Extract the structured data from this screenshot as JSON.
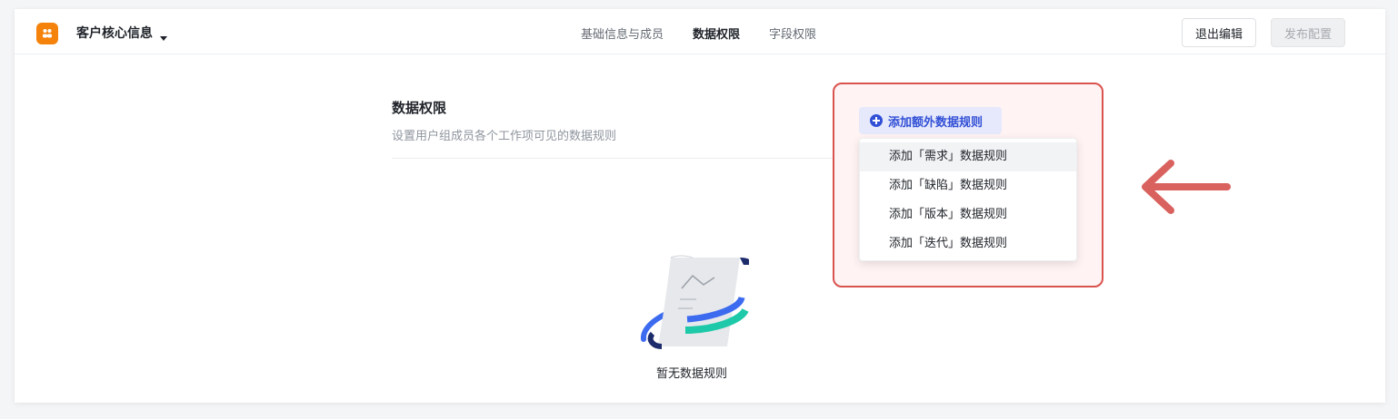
{
  "header": {
    "project_name": "客户核心信息",
    "tabs": [
      {
        "label": "基础信息与成员",
        "active": false
      },
      {
        "label": "数据权限",
        "active": true
      },
      {
        "label": "字段权限",
        "active": false
      }
    ],
    "exit_edit_label": "退出编辑",
    "publish_label": "发布配置"
  },
  "section": {
    "title": "数据权限",
    "description": "设置用户组成员各个工作项可见的数据规则"
  },
  "add_rule": {
    "button_label": "添加额外数据规则",
    "menu_items": [
      "添加「需求」数据规则",
      "添加「缺陷」数据规则",
      "添加「版本」数据规则",
      "添加「迭代」数据规则"
    ]
  },
  "empty_state": {
    "text": "暂无数据规则"
  },
  "colors": {
    "logo": "#f5820a",
    "accent": "#3250d6",
    "highlight": "#d9534f"
  }
}
